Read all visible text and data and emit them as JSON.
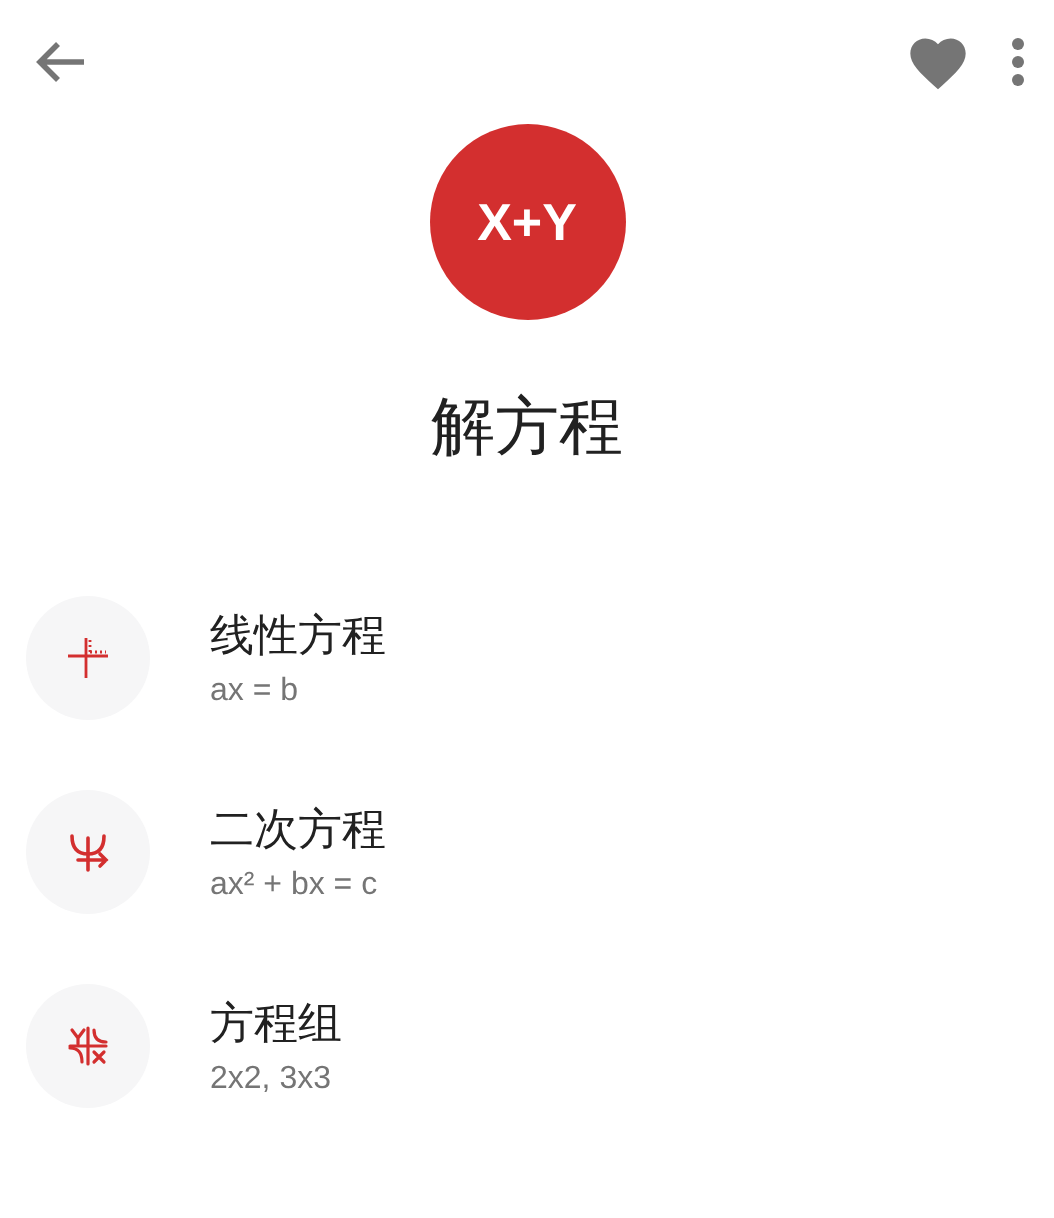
{
  "logo": {
    "text": "X+Y"
  },
  "title": "解方程",
  "items": [
    {
      "kind": "linear",
      "title": "线性方程",
      "subtitle": "ax = b"
    },
    {
      "kind": "quadratic",
      "title": "二次方程",
      "subtitle": "ax² + bx = c"
    },
    {
      "kind": "system",
      "title": "方程组",
      "subtitle": "2x2, 3x3"
    }
  ]
}
